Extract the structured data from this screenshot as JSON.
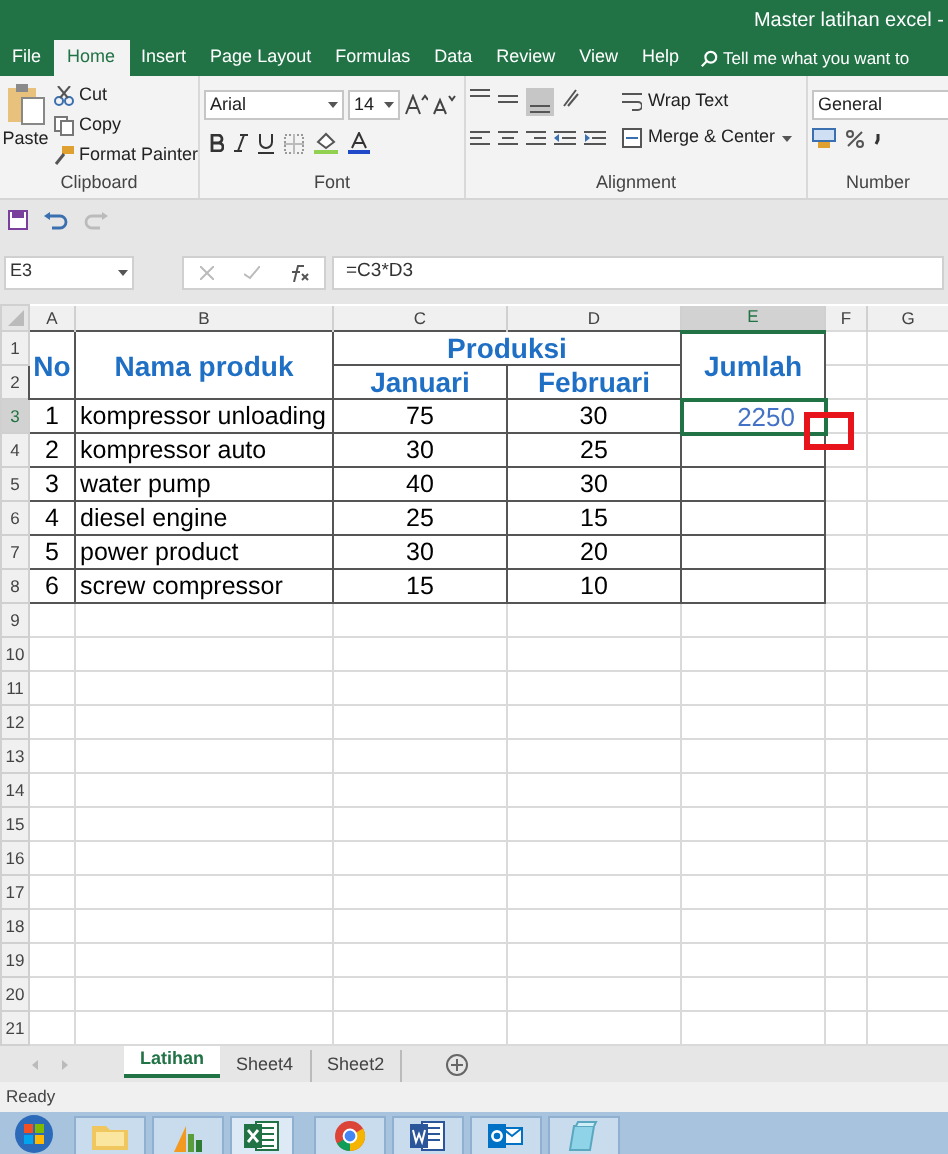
{
  "window": {
    "title": "Master latihan excel -"
  },
  "ribbon_tabs": [
    {
      "label": "File",
      "selected": false
    },
    {
      "label": "Home",
      "selected": true
    },
    {
      "label": "Insert",
      "selected": false
    },
    {
      "label": "Page Layout",
      "selected": false
    },
    {
      "label": "Formulas",
      "selected": false
    },
    {
      "label": "Data",
      "selected": false
    },
    {
      "label": "Review",
      "selected": false
    },
    {
      "label": "View",
      "selected": false
    },
    {
      "label": "Help",
      "selected": false
    }
  ],
  "tell_me": {
    "placeholder": "Tell me what you want to"
  },
  "clipboard": {
    "paste": "Paste",
    "cut": "Cut",
    "copy": "Copy",
    "format_painter": "Format Painter",
    "label": "Clipboard"
  },
  "font": {
    "name": "Arial",
    "size": "14",
    "label": "Font"
  },
  "alignment": {
    "wrap_text": "Wrap Text",
    "merge_center": "Merge & Center",
    "label": "Alignment"
  },
  "number": {
    "format": "General",
    "label": "Number"
  },
  "name_box": "E3",
  "formula": "=C3*D3",
  "columns": [
    "A",
    "B",
    "C",
    "D",
    "E",
    "F",
    "G"
  ],
  "row_numbers": [
    "1",
    "2",
    "3",
    "4",
    "5",
    "6",
    "7",
    "8",
    "9",
    "10",
    "11",
    "12",
    "13",
    "14",
    "15",
    "16",
    "17",
    "18",
    "19",
    "20",
    "21"
  ],
  "header": {
    "no": "No",
    "product": "Nama produk",
    "produksi": "Produksi",
    "januari": "Januari",
    "februari": "Februari",
    "jumlah": "Jumlah"
  },
  "data_rows": [
    {
      "no": "1",
      "product": "kompressor unloading",
      "januari": "75",
      "februari": "30",
      "jumlah": "2250",
      "selected": true
    },
    {
      "no": "2",
      "product": "kompressor auto",
      "januari": "30",
      "februari": "25",
      "selected": false
    },
    {
      "no": "3",
      "product": "water pump",
      "januari": "40",
      "februari": "30",
      "selected": false
    },
    {
      "no": "4",
      "product": "diesel engine",
      "januari": "25",
      "februari": "15",
      "selected": false
    },
    {
      "no": "5",
      "product": "power product",
      "januari": "30",
      "februari": "20",
      "selected": false
    },
    {
      "no": "6",
      "product": "screw compressor",
      "januari": "15",
      "februari": "10",
      "selected": false
    }
  ],
  "sheet_tabs": [
    {
      "label": "Latihan",
      "selected": true
    },
    {
      "label": "Sheet4",
      "selected": false
    },
    {
      "label": "Sheet2",
      "selected": false
    }
  ],
  "status_bar": "Ready"
}
